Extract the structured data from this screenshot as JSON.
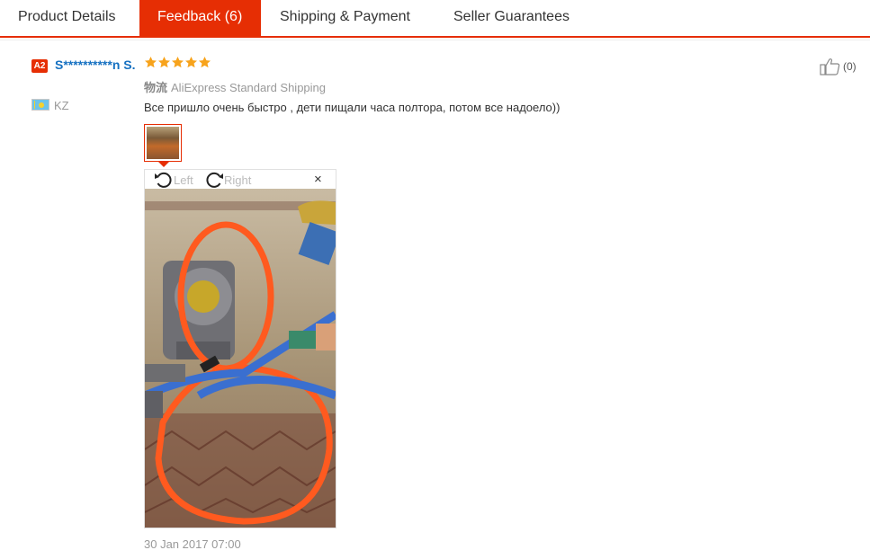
{
  "tabs": [
    {
      "label": "Product Details"
    },
    {
      "label": "Feedback (6)"
    },
    {
      "label": "Shipping & Payment"
    },
    {
      "label": "Seller Guarantees"
    }
  ],
  "reviewer": {
    "level_badge": "A2",
    "name": "S**********n S.",
    "country": "KZ"
  },
  "review": {
    "rating": 5,
    "shipping_label": "物流",
    "shipping_method": "AliExpress Standard Shipping",
    "text": "Все пришло очень быстро , дети пищали часа полтора, потом все надоело))",
    "helpful_count": "(0)",
    "date": "30 Jan 2017 07:00"
  },
  "viewer": {
    "rotate_left": "Left",
    "rotate_right": "Right",
    "close": "×"
  },
  "colors": {
    "accent": "#e62e04",
    "star": "#f7a31c",
    "link": "#1570c1"
  }
}
